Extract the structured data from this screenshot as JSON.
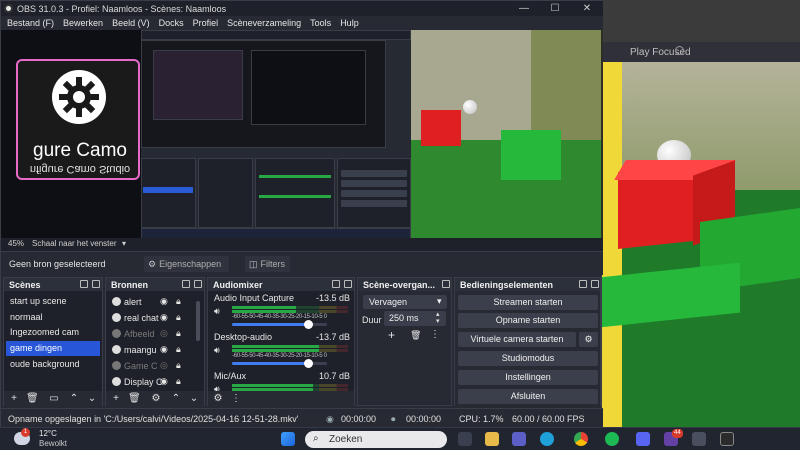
{
  "window": {
    "title": "OBS 31.0.3 - Profiel: Naamloos - Scènes: Naamloos",
    "minimize": "—",
    "maximize": "☐",
    "close": "✕"
  },
  "menu": [
    "Bestand (F)",
    "Bewerken",
    "Beeld (V)",
    "Docks",
    "Profiel",
    "Scèneverzameling",
    "Tools",
    "Hulp"
  ],
  "background_window": {
    "title": "Play Focused"
  },
  "camo_overlay": {
    "label": "gure Camo",
    "mirrored_label": "nfigure Camo Studio"
  },
  "zoom": {
    "percent": "45%",
    "mode": "Schaal naar het venster",
    "dropdown_glyph": "▾"
  },
  "source_toolbar": {
    "label": "Geen bron geselecteerd",
    "properties": "Eigenschappen",
    "filters": "Filters"
  },
  "scenes": {
    "title": "Scènes",
    "items": [
      "start up scene",
      "normaal",
      "Ingezoomed cam",
      "game dingen",
      "oude background"
    ],
    "selected": "game dingen"
  },
  "sources": {
    "title": "Bronnen",
    "items": [
      {
        "name": "alert"
      },
      {
        "name": "real chat"
      },
      {
        "name": "Afbeeld"
      },
      {
        "name": "maangu"
      },
      {
        "name": "Game C"
      },
      {
        "name": "Display C"
      }
    ]
  },
  "mixer": {
    "title": "Audiomixer",
    "channels": [
      {
        "name": "Audio Input Capture",
        "db": "-13.5 dB",
        "level": 0.55,
        "volume": 0.8
      },
      {
        "name": "Desktop-audio",
        "db": "-13.7 dB",
        "level": 0.75,
        "volume": 0.8
      },
      {
        "name": "Mic/Aux",
        "db": "10.7 dB",
        "level": 0.7,
        "volume": 0.8
      }
    ],
    "ticks": "-60-55-50-45-40-35-30-25-20-15-10-5 0"
  },
  "transitions": {
    "title": "Scène-overgan...",
    "type": "Vervagen",
    "duration_label": "Duur",
    "duration": "250 ms"
  },
  "controls": {
    "title": "Bedieningselementen",
    "buttons": [
      "Streamen starten",
      "Opname starten",
      "Virtuele camera starten",
      "Studiomodus",
      "Instellingen",
      "Afsluiten"
    ]
  },
  "status": {
    "message": "Opname opgeslagen in 'C:/Users/calvi/Videos/2025-04-16 12-51-28.mkv'",
    "stream_time": "00:00:00",
    "rec_time": "00:00:00",
    "cpu": "CPU: 1.7%",
    "fps": "60.00 / 60.00 FPS"
  },
  "taskbar": {
    "weather_temp": "12°C",
    "weather_desc": "Bewolkt",
    "weather_badge": "1",
    "search_placeholder": "Zoeken",
    "notification_badge": "44"
  },
  "colors": {
    "accent": "#2757d8",
    "camo_border": "#e76ac9",
    "meter_green": "#28a745",
    "meter_yellow": "#c9b22c",
    "meter_red": "#b63a3a"
  }
}
